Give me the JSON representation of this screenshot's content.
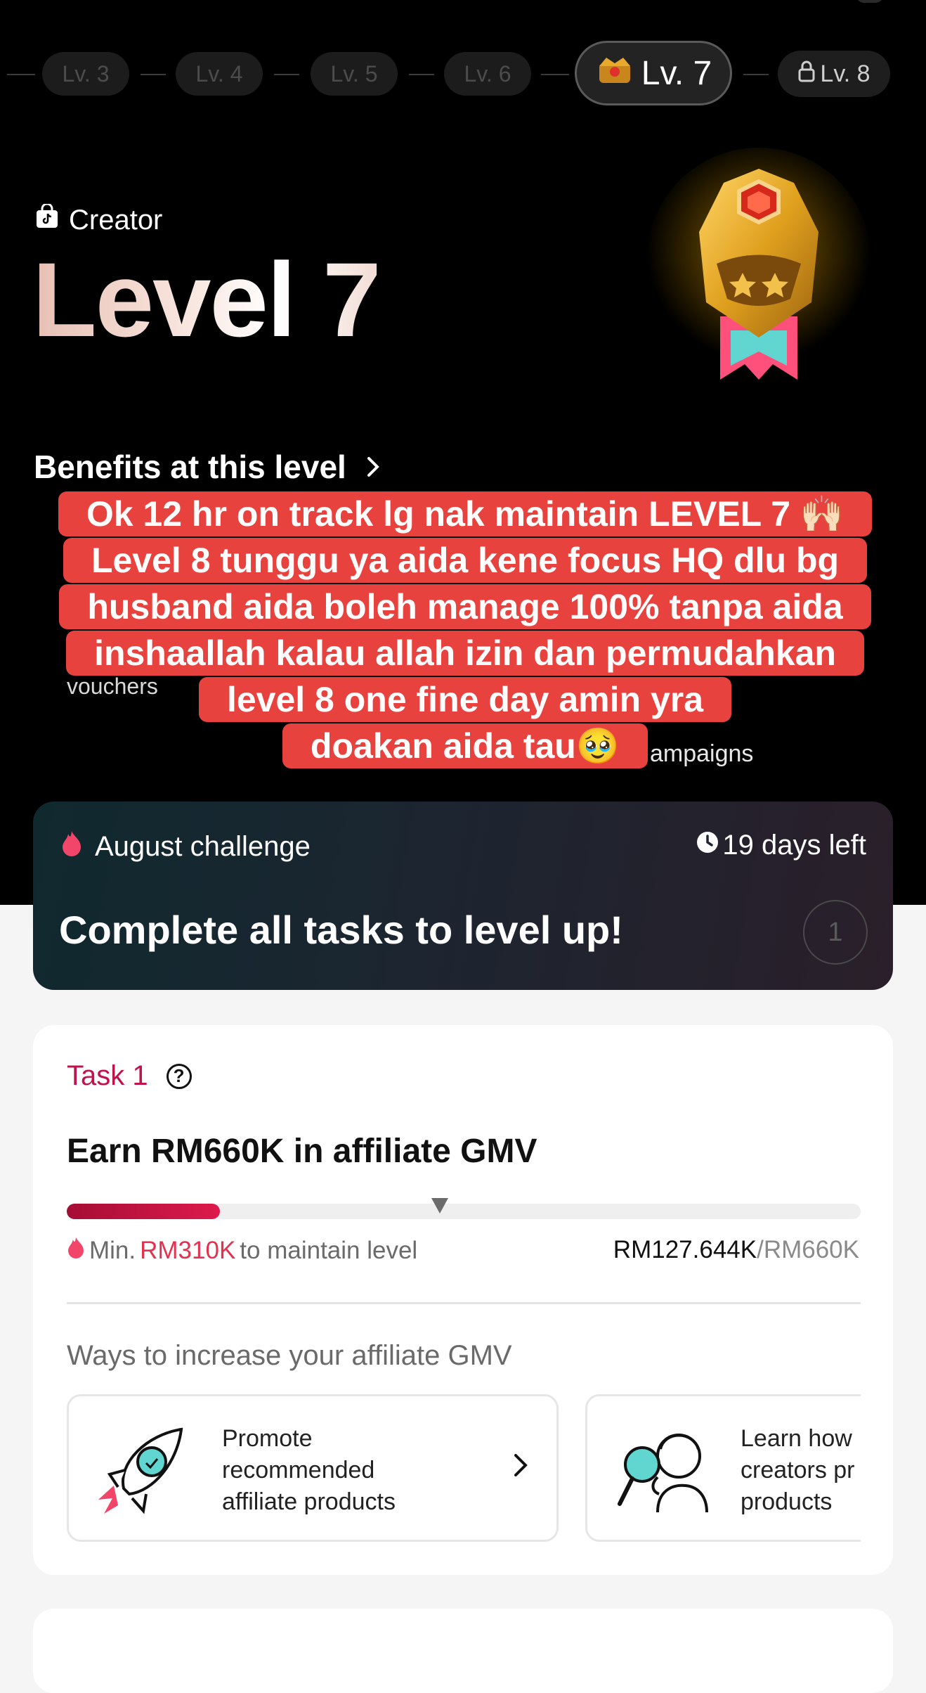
{
  "level_selector": {
    "levels": [
      "Lv. 3",
      "Lv. 4",
      "Lv. 5",
      "Lv. 6"
    ],
    "current": "Lv. 7",
    "next_locked": "Lv. 8"
  },
  "hero": {
    "creator_label": "Creator",
    "level_title": "Level 7",
    "benefits_label": "Benefits at this level",
    "benefit_partial_left": "vouchers",
    "benefit_partial_right": "ampaigns"
  },
  "caption": {
    "lines": [
      "Ok 12 hr on track lg nak maintain LEVEL 7 🙌🏻",
      "Level 8 tunggu ya aida kene focus HQ dlu bg",
      "husband aida boleh manage 100% tanpa aida",
      "inshaallah kalau allah izin dan permudahkan",
      "level 8 one fine day amin yra",
      "doakan aida tau🥹"
    ]
  },
  "challenge": {
    "title": "August challenge",
    "days_left": "19 days left",
    "headline": "Complete all tasks to level up!",
    "step": "1"
  },
  "task": {
    "label": "Task 1",
    "goal": "Earn RM660K in affiliate GMV",
    "progress_fraction": 0.193,
    "min_marker_fraction": 0.47,
    "min_prefix": "Min.",
    "min_amount": "RM310K",
    "min_suffix": "to maintain level",
    "current_gmv": "RM127.644K",
    "target_gmv": "/RM660K",
    "ways_title": "Ways to increase your affiliate GMV",
    "ways": [
      {
        "text": "Promote\nrecommended\naffiliate products",
        "icon": "rocket-icon"
      },
      {
        "text": "Learn how\ncreators pr\nproducts",
        "icon": "magnifier-person-icon"
      }
    ]
  },
  "colors": {
    "accent_red": "#c0134a",
    "caption_bg": "#e8423f",
    "amount_red": "#e2324f"
  }
}
